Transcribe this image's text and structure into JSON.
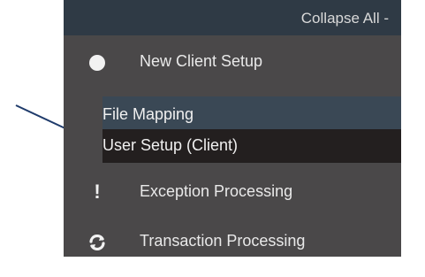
{
  "header": {
    "collapse_label": "Collapse All -"
  },
  "menu": {
    "items": [
      {
        "label": "New Client Setup",
        "icon": "circle-icon"
      },
      {
        "label": "Exception Processing",
        "icon": "exclamation-icon"
      },
      {
        "label": "Transaction Processing",
        "icon": "refresh-icon"
      }
    ],
    "subitems": [
      {
        "label": "File Mapping"
      },
      {
        "label": "User Setup (Client)"
      }
    ]
  },
  "colors": {
    "panel_bg": "#4a4849",
    "header_bg": "#2f3a45",
    "subitem_bg": "#3a4855",
    "selected_bg": "#231f1f",
    "arrow": "#1f3b6b"
  }
}
